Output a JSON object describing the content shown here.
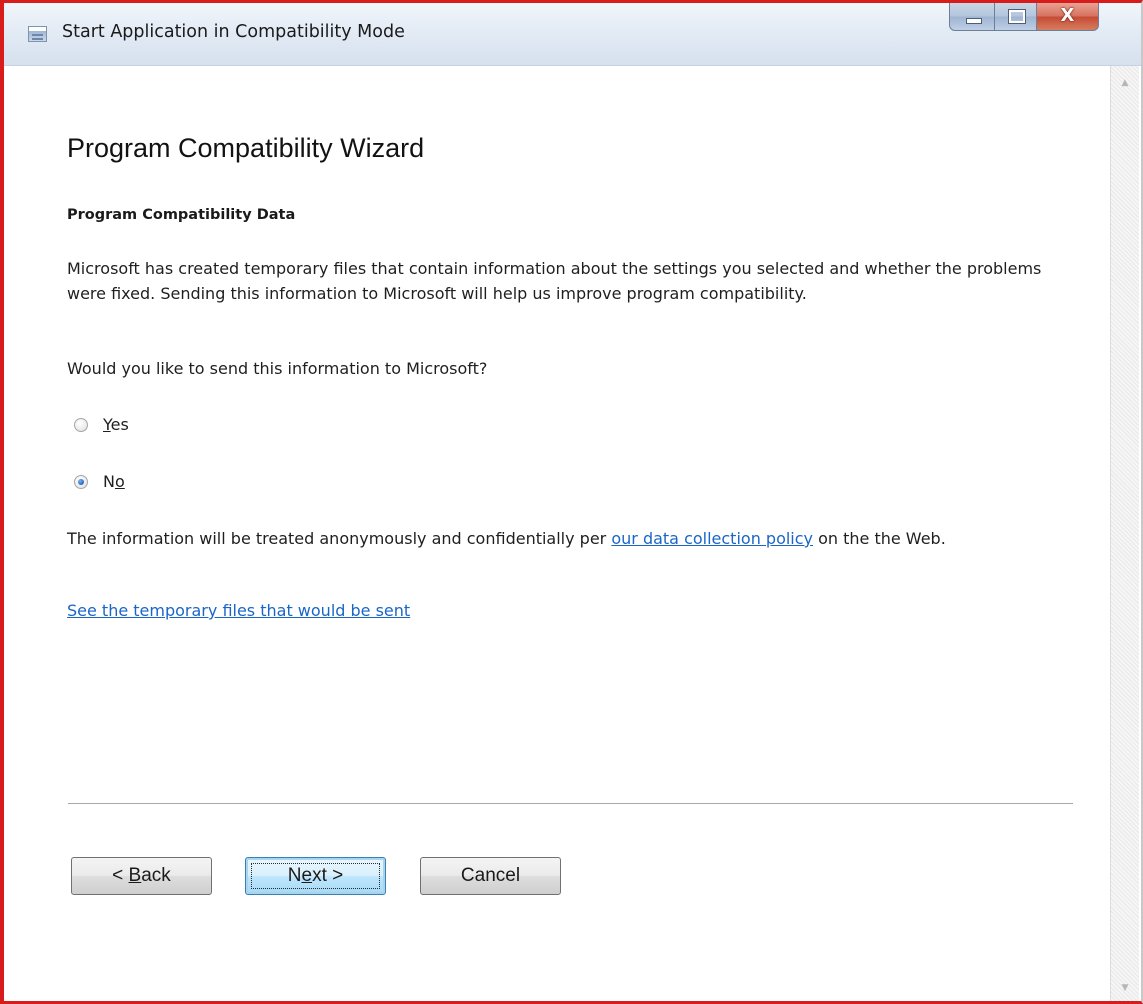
{
  "window": {
    "title": "Start Application in Compatibility Mode",
    "controls": {
      "minimize_icon": "minimize-icon",
      "maximize_icon": "maximize-icon",
      "close_icon": "close-icon",
      "close_glyph": "X"
    }
  },
  "wizard": {
    "heading": "Program Compatibility Wizard",
    "subheading": "Program Compatibility Data",
    "description": "Microsoft has created temporary files that contain information about the settings you selected and whether the problems were fixed. Sending this information to Microsoft will help us improve program compatibility.",
    "question": "Would you like to send this information to Microsoft?",
    "options": [
      {
        "label_before": "",
        "accel": "Y",
        "label_after": "es",
        "selected": false
      },
      {
        "label_before": "N",
        "accel": "o",
        "label_after": "",
        "selected": true
      }
    ],
    "info_prefix": "The information will be treated anonymously and confidentially per ",
    "info_link": "our data collection policy",
    "info_suffix": " on the the Web.",
    "files_link": "See the temporary files that would be sent"
  },
  "buttons": {
    "back": {
      "before": "< ",
      "accel": "B",
      "after": "ack"
    },
    "next": {
      "before": "N",
      "accel": "e",
      "after": "xt >"
    },
    "cancel": {
      "label": "Cancel"
    }
  },
  "colors": {
    "accent_border": "#d81c1c",
    "link": "#1a66c7",
    "radio_selected": "#2c6fd1"
  }
}
